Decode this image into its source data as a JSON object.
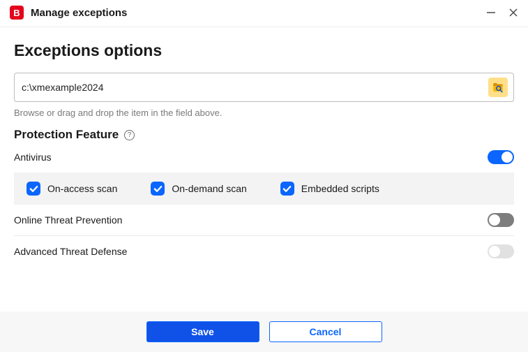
{
  "titlebar": {
    "app_icon_letter": "B",
    "title": "Manage exceptions"
  },
  "page": {
    "heading": "Exceptions options",
    "path_value": "c:\\xmexample2024",
    "hint": "Browse or drag and drop the item in the field above."
  },
  "protection": {
    "section_label": "Protection Feature",
    "help_glyph": "?",
    "features": [
      {
        "name": "Antivirus",
        "enabled": true
      },
      {
        "name": "Online Threat Prevention",
        "enabled": false,
        "style": "dark"
      },
      {
        "name": "Advanced Threat Defense",
        "enabled": false,
        "style": "light"
      }
    ],
    "antivirus_subopts": [
      {
        "label": "On-access scan",
        "checked": true
      },
      {
        "label": "On-demand scan",
        "checked": true
      },
      {
        "label": "Embedded scripts",
        "checked": true
      }
    ]
  },
  "footer": {
    "save": "Save",
    "cancel": "Cancel"
  }
}
